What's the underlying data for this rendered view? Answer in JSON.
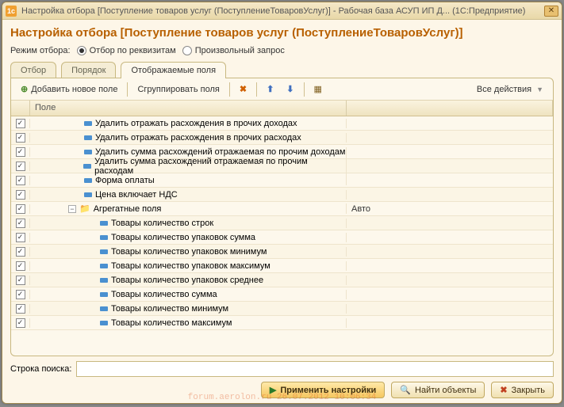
{
  "titlebar": {
    "icon_text": "1c",
    "title": "Настройка отбора [Поступление товаров услуг (ПоступлениеТоваровУслуг)] - Рабочая база  АСУП ИП Д...  (1С:Предприятие)"
  },
  "header": {
    "title": "Настройка отбора [Поступление товаров услуг (ПоступлениеТоваровУслуг)]"
  },
  "mode": {
    "label": "Режим отбора:",
    "option1": "Отбор по реквизитам",
    "option2": "Произвольный запрос",
    "selected": 1
  },
  "tabs": {
    "items": [
      "Отбор",
      "Порядок",
      "Отображаемые поля"
    ],
    "active": 2
  },
  "toolbar": {
    "add": "Добавить новое поле",
    "group": "Сгруппировать поля",
    "all_actions": "Все действия"
  },
  "grid": {
    "col_field": "Поле",
    "auto_label": "Авто",
    "rows": [
      {
        "chk": true,
        "indent": 60,
        "kind": "leaf",
        "label": "Удалить отражать расхождения в прочих доходах",
        "auto": ""
      },
      {
        "chk": true,
        "indent": 60,
        "kind": "leaf",
        "label": "Удалить отражать расхождения в прочих расходах",
        "auto": ""
      },
      {
        "chk": true,
        "indent": 60,
        "kind": "leaf",
        "label": "Удалить сумма расхождений отражаемая по прочим доходам",
        "auto": ""
      },
      {
        "chk": true,
        "indent": 60,
        "kind": "leaf",
        "label": "Удалить сумма расхождений отражаемая по прочим расходам",
        "auto": ""
      },
      {
        "chk": true,
        "indent": 60,
        "kind": "leaf",
        "label": "Форма оплаты",
        "auto": ""
      },
      {
        "chk": true,
        "indent": 60,
        "kind": "leaf",
        "label": "Цена включает НДС",
        "auto": ""
      },
      {
        "chk": true,
        "indent": 40,
        "kind": "folder",
        "label": "Агрегатные поля",
        "auto": "Авто"
      },
      {
        "chk": true,
        "indent": 80,
        "kind": "leaf",
        "label": "Товары количество строк",
        "auto": ""
      },
      {
        "chk": true,
        "indent": 80,
        "kind": "leaf",
        "label": "Товары количество упаковок сумма",
        "auto": ""
      },
      {
        "chk": true,
        "indent": 80,
        "kind": "leaf",
        "label": "Товары количество упаковок минимум",
        "auto": ""
      },
      {
        "chk": true,
        "indent": 80,
        "kind": "leaf",
        "label": "Товары количество упаковок максимум",
        "auto": ""
      },
      {
        "chk": true,
        "indent": 80,
        "kind": "leaf",
        "label": "Товары количество упаковок среднее",
        "auto": ""
      },
      {
        "chk": true,
        "indent": 80,
        "kind": "leaf",
        "label": "Товары количество сумма",
        "auto": ""
      },
      {
        "chk": true,
        "indent": 80,
        "kind": "leaf",
        "label": "Товары количество минимум",
        "auto": ""
      },
      {
        "chk": true,
        "indent": 80,
        "kind": "leaf",
        "label": "Товары количество максимум",
        "auto": ""
      }
    ]
  },
  "search": {
    "label": "Строка поиска:",
    "value": ""
  },
  "footer": {
    "apply": "Применить настройки",
    "find": "Найти объекты",
    "close": "Закрыть"
  },
  "watermark": "forum.aerolon.ru 26.07.2012 10:06:34"
}
